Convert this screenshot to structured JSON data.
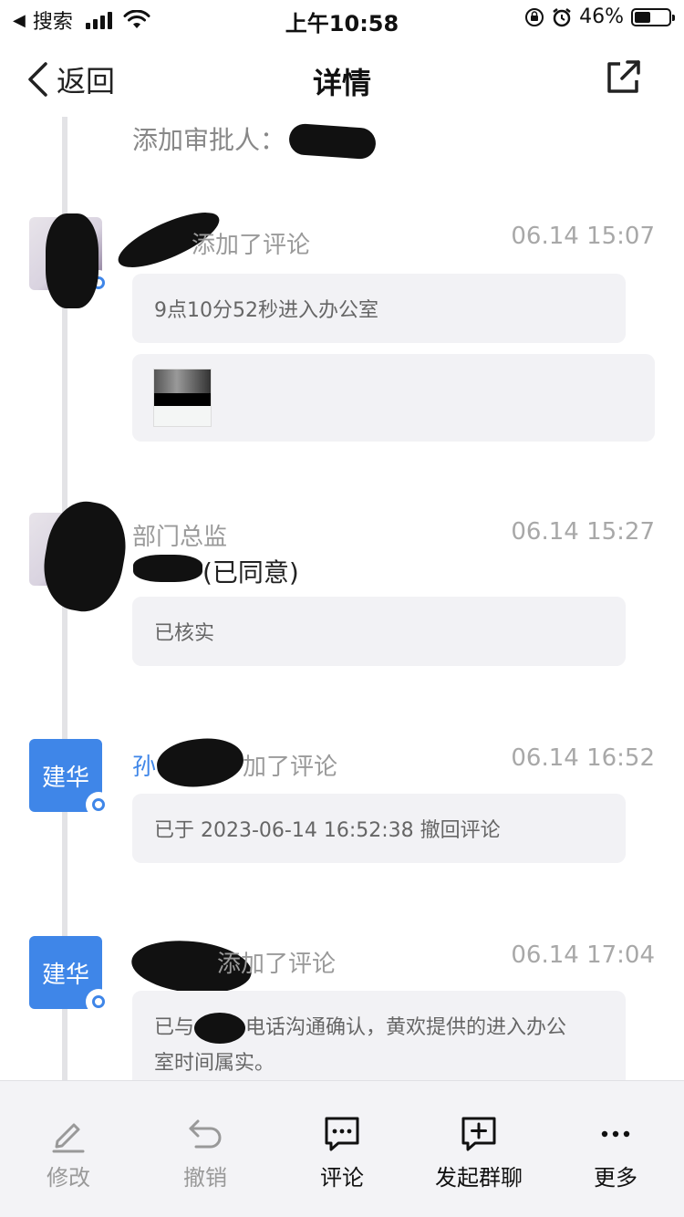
{
  "status_bar": {
    "back_app": "搜索",
    "time": "上午10:58",
    "battery": "46%",
    "battery_level": 0.46
  },
  "nav": {
    "back_label": "返回",
    "title": "详情"
  },
  "timeline": {
    "top_entry": {
      "label": "添加审批人："
    },
    "entries": [
      {
        "action": "添加了评论",
        "time": "06.14 15:07",
        "comment": "9点10分52秒进入办公室"
      },
      {
        "role": "部门总监",
        "time": "06.14 15:27",
        "status": "(已同意)",
        "comment": "已核实"
      },
      {
        "avatar_text": "建华",
        "name_prefix": "孙",
        "action": "加了评论",
        "time": "06.14 16:52",
        "comment": "已于 2023-06-14 16:52:38 撤回评论"
      },
      {
        "avatar_text": "建华",
        "action": "添加了评论",
        "time": "06.14 17:04",
        "comment_part1": "已与",
        "comment_part2": "电话沟通确认，黄欢提供的进入办公",
        "comment_line2": "室时间属实。"
      }
    ]
  },
  "toolbar": {
    "items": [
      {
        "label": "修改",
        "icon": "pencil-icon",
        "enabled": false
      },
      {
        "label": "撤销",
        "icon": "undo-icon",
        "enabled": false
      },
      {
        "label": "评论",
        "icon": "comment-icon",
        "enabled": true
      },
      {
        "label": "发起群聊",
        "icon": "group-chat-icon",
        "enabled": true
      },
      {
        "label": "更多",
        "icon": "more-icon",
        "enabled": true
      }
    ]
  },
  "colors": {
    "accent": "#3f86e8",
    "bubble": "#f2f2f5",
    "muted_text": "#9a9a9a"
  }
}
